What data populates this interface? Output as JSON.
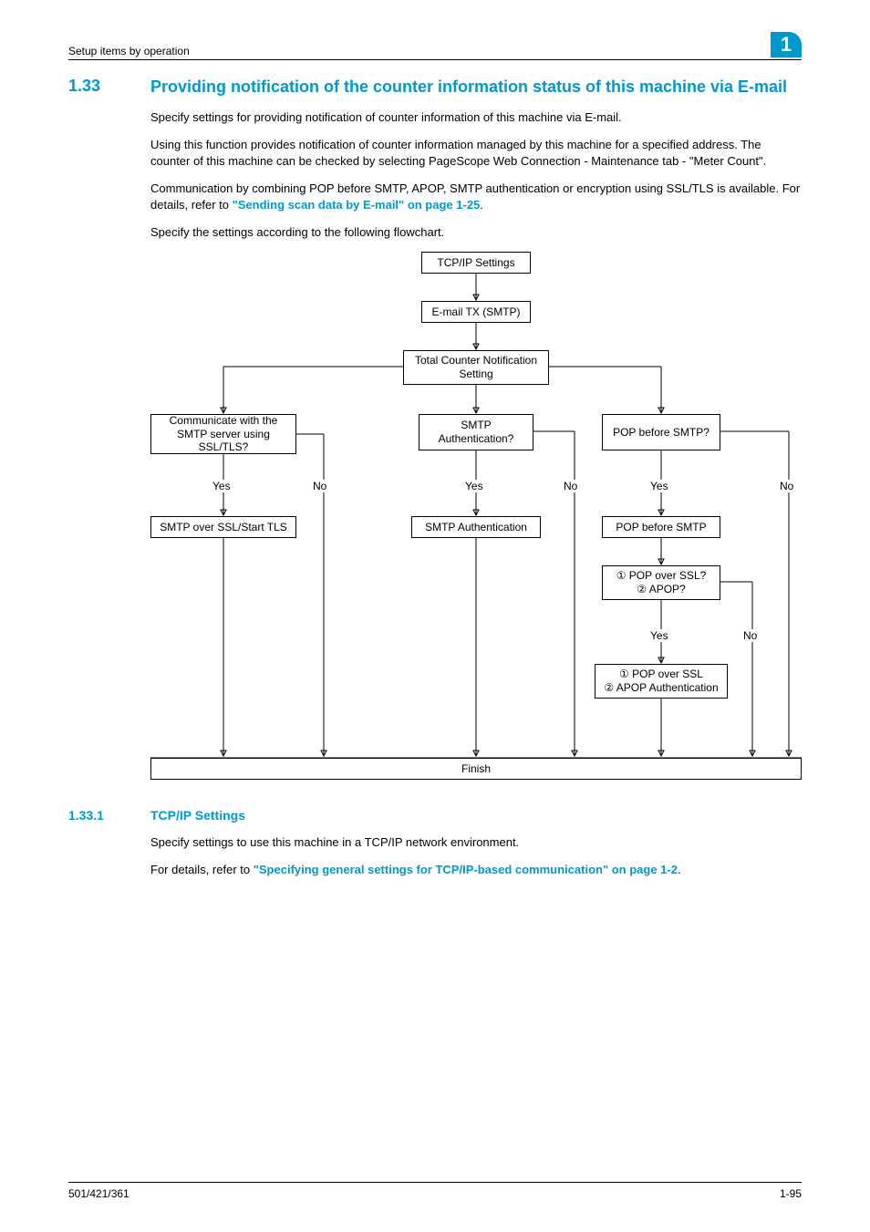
{
  "header": {
    "breadcrumb": "Setup items by operation",
    "chapter": "1"
  },
  "section": {
    "number": "1.33",
    "title": "Providing notification of the counter information status of this machine via E-mail"
  },
  "para1": "Specify settings for providing notification of counter information of this machine via E-mail.",
  "para2": "Using this function provides notification of counter information managed by this machine for a specified address. The counter of this machine can be checked by selecting PageScope Web Connection - Maintenance tab - \"Meter Count\".",
  "para3a": "Communication by combining POP before SMTP, APOP, SMTP authentication or encryption using SSL/TLS is available. For details, refer to ",
  "para3link": "\"Sending scan data by E-mail\" on page 1-25",
  "para3b": ".",
  "para4": "Specify the settings according to the following flowchart.",
  "flow": {
    "b1": "TCP/IP Settings",
    "b2": "E-mail TX (SMTP)",
    "b3": "Total Counter Notification Setting",
    "q1": "Communicate with the SMTP server using SSL/TLS?",
    "q2": "SMTP Authentication?",
    "q3": "POP before SMTP?",
    "a1": "SMTP over SSL/Start TLS",
    "a2": "SMTP Authentication",
    "a3": "POP before SMTP",
    "q4": "① POP over SSL?\n② APOP?",
    "a4": "① POP over SSL\n② APOP Authentication",
    "finish": "Finish",
    "yes": "Yes",
    "no": "No"
  },
  "subsection": {
    "number": "1.33.1",
    "title": "TCP/IP Settings"
  },
  "sub_p1": "Specify settings to use this machine in a TCP/IP network environment.",
  "sub_p2a": "For details, refer to ",
  "sub_p2link": "\"Specifying general settings for TCP/IP-based communication\" on page 1-2",
  "sub_p2b": ".",
  "footer": {
    "left": "501/421/361",
    "right": "1-95"
  }
}
